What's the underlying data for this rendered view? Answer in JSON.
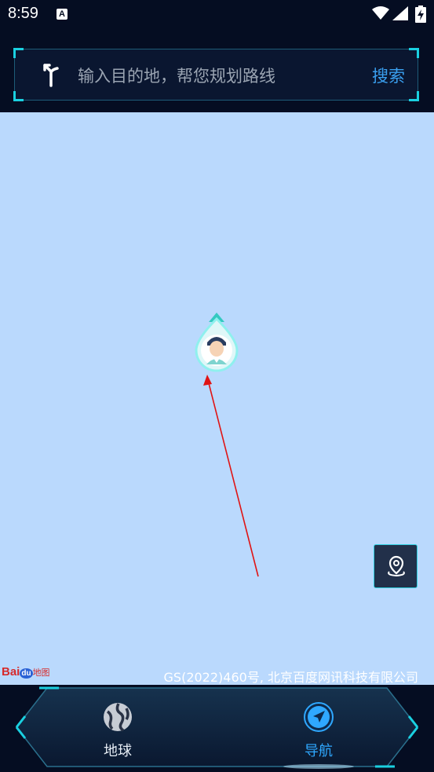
{
  "status_bar": {
    "time": "8:59",
    "notification": "A"
  },
  "search": {
    "placeholder": "输入目的地，帮您规划路线",
    "button_label": "搜索"
  },
  "map": {
    "logo_text_bai": "Bai",
    "logo_text_du": "du",
    "logo_text_map": "地图",
    "copyright": "GS(2022)460号, 北京百度网讯科技有限公司"
  },
  "bottom_nav": {
    "tabs": [
      {
        "label": "地球",
        "icon": "globe-icon",
        "active": false
      },
      {
        "label": "导航",
        "icon": "navigation-icon",
        "active": true
      }
    ],
    "active_color": "#2fa8ff"
  },
  "colors": {
    "map_background": "#bad9fd",
    "accent": "#1ad0e0",
    "search_link": "#3aa0f0"
  }
}
